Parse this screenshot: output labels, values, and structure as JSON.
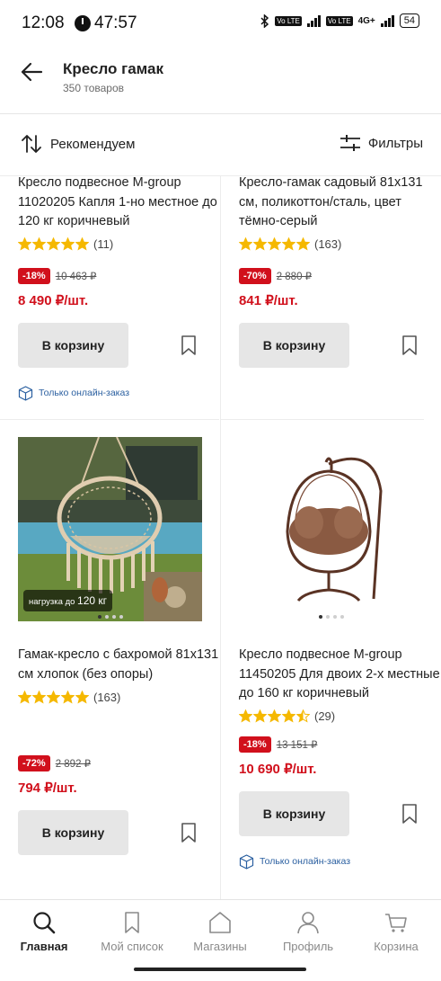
{
  "status_bar": {
    "time": "12:08",
    "timer": "47:57",
    "network": "4G+",
    "volte1": "Vo LTE",
    "volte2": "Vo LTE",
    "battery": "54"
  },
  "header": {
    "title": "Кресло гамак",
    "subtitle": "350 товаров"
  },
  "toolbar": {
    "sort_label": "Рекомендуем",
    "filter_label": "Фильтры"
  },
  "products": [
    {
      "name": "Кресло подвесное M-group 11020205 Капля 1-но местное до 120 кг коричневый",
      "rating_stars": 5,
      "rating_count": "(11)",
      "discount": "-18%",
      "old_price": "10 463 ₽",
      "price": "8 490",
      "unit": "₽/шт.",
      "cart_label": "В корзину",
      "online_note": "Только онлайн-заказ"
    },
    {
      "name": "Кресло-гамак садовый 81x131 см, поликоттон/сталь, цвет тёмно-серый",
      "rating_stars": 5,
      "rating_count": "(163)",
      "discount": "-70%",
      "old_price": "2 880 ₽",
      "price": "841",
      "unit": "₽/шт.",
      "cart_label": "В корзину"
    },
    {
      "name": "Гамак-кресло с бахромой 81x131 см хлопок (без опоры)",
      "rating_stars": 5,
      "rating_count": "(163)",
      "discount": "-72%",
      "old_price": "2 892 ₽",
      "price": "794",
      "unit": "₽/шт.",
      "cart_label": "В корзину",
      "image_badge_prefix": "нагрузка до",
      "image_badge_value": "120 кг",
      "image_page": 1,
      "image_pages": 4
    },
    {
      "name": "Кресло подвесное M-group 11450205 Для двоих 2-х местные до 160 кг коричневый",
      "rating_stars": 4.5,
      "rating_count": "(29)",
      "discount": "-18%",
      "old_price": "13 151 ₽",
      "price": "10 690",
      "unit": "₽/шт.",
      "cart_label": "В корзину",
      "online_note": "Только онлайн-заказ",
      "image_page": 1,
      "image_pages": 4
    }
  ],
  "bottom_nav": [
    {
      "label": "Главная",
      "icon": "search-icon",
      "active": true
    },
    {
      "label": "Мой список",
      "icon": "bookmark-icon",
      "active": false
    },
    {
      "label": "Магазины",
      "icon": "store-icon",
      "active": false
    },
    {
      "label": "Профиль",
      "icon": "profile-icon",
      "active": false
    },
    {
      "label": "Корзина",
      "icon": "cart-icon",
      "active": false
    }
  ],
  "colors": {
    "accent": "#d1101c",
    "button_bg": "#e6e6e6",
    "star": "#f5b800",
    "link": "#2a5fa0"
  }
}
